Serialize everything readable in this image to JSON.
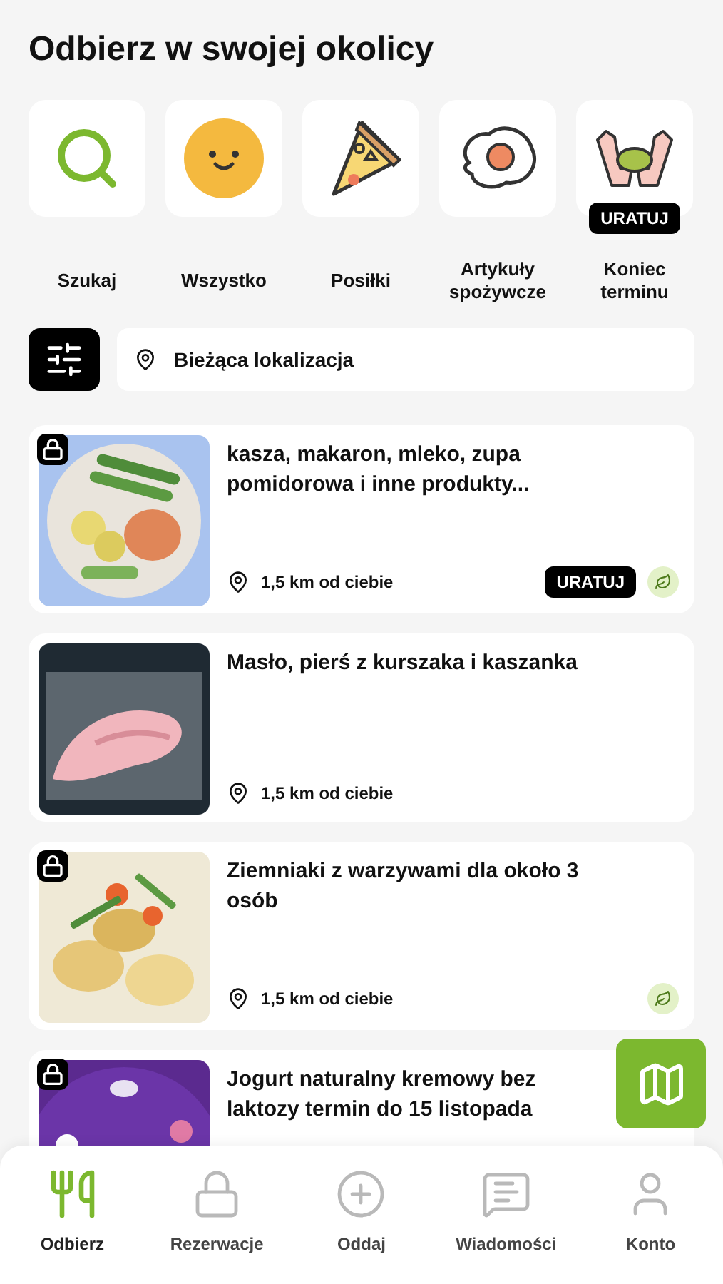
{
  "title": "Odbierz w swojej okolicy",
  "categories": [
    {
      "kind": "search",
      "label": "Szukaj"
    },
    {
      "kind": "smiley",
      "label": "Wszystko"
    },
    {
      "kind": "pizza",
      "label": "Posiłki"
    },
    {
      "kind": "egg",
      "label": "Artykuły spożywcze"
    },
    {
      "kind": "hands",
      "label": "Koniec terminu",
      "badge": "URATUJ"
    }
  ],
  "location": {
    "value": "Bieżąca lokalizacja"
  },
  "listings": [
    {
      "title": "kasza, makaron, mleko, zupa pomidorowa i inne produkty...",
      "distance": "1,5 km od ciebie",
      "locked": true,
      "badge": "URATUJ",
      "eco": true
    },
    {
      "title": "Masło, pierś z kurszaka i kaszanka",
      "distance": "1,5 km od ciebie",
      "locked": false,
      "eco": false
    },
    {
      "title": "Ziemniaki z warzywami dla około 3 osób",
      "distance": "1,5 km od ciebie",
      "locked": true,
      "eco": true
    },
    {
      "title": "Jogurt naturalny kremowy bez laktozy termin do 15 listopada",
      "locked": true,
      "eco": false
    }
  ],
  "nav": [
    {
      "kind": "food",
      "label": "Odbierz",
      "selected": true
    },
    {
      "kind": "lock",
      "label": "Rezerwacje",
      "selected": false
    },
    {
      "kind": "plus",
      "label": "Oddaj",
      "selected": false
    },
    {
      "kind": "chat",
      "label": "Wiadomości",
      "selected": false
    },
    {
      "kind": "user",
      "label": "Konto",
      "selected": false
    }
  ]
}
